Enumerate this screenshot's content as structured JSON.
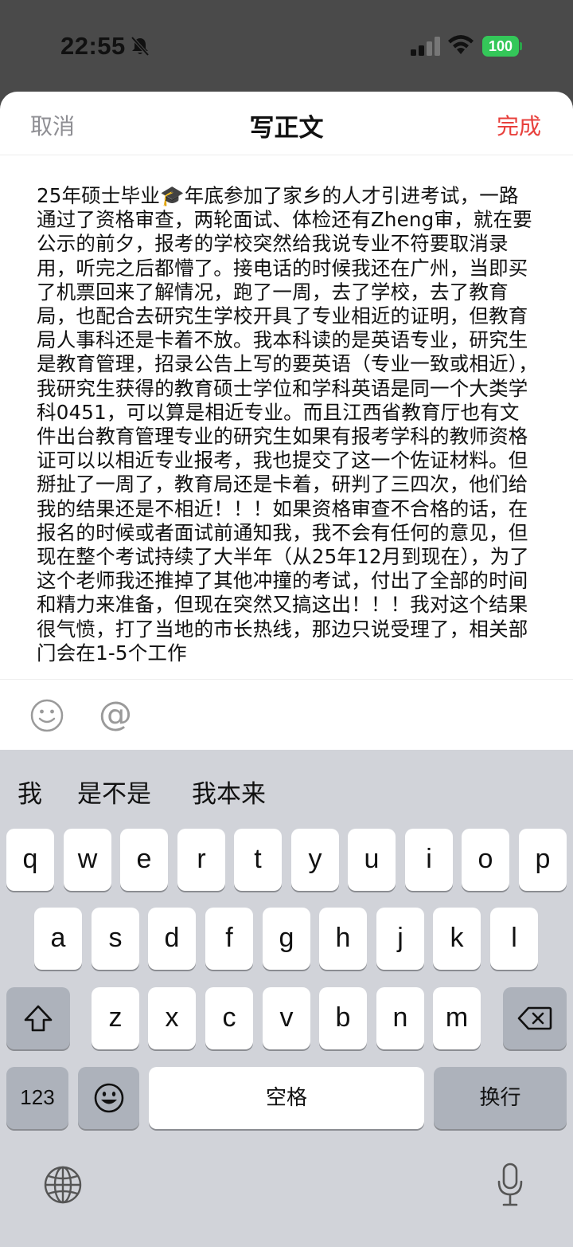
{
  "status": {
    "time": "22:55",
    "battery": "100",
    "icons": [
      "bell-slash-icon",
      "cellular-signal-icon",
      "wifi-icon",
      "battery-icon"
    ]
  },
  "nav": {
    "cancel": "取消",
    "title": "写正文",
    "done": "完成"
  },
  "editor": {
    "text": "25年硕士毕业🎓年底参加了家乡的人才引进考试，一路通过了资格审查，两轮面试、体检还有Zheng审，就在要公示的前夕，报考的学校突然给我说专业不符要取消录用，听完之后都懵了。接电话的时候我还在广州，当即买了机票回来了解情况，跑了一周，去了学校，去了教育局，也配合去研究生学校开具了专业相近的证明，但教育局人事科还是卡着不放。我本科读的是英语专业，研究生是教育管理，招录公告上写的要英语（专业一致或相近），我研究生获得的教育硕士学位和学科英语是同一个大类学科0451，可以算是相近专业。而且江西省教育厅也有文件出台教育管理专业的研究生如果有报考学科的教师资格证可以以相近专业报考，我也提交了这一个佐证材料。但掰扯了一周了，教育局还是卡着，研判了三四次，他们给我的结果还是不相近！！！如果资格审查不合格的话，在报名的时候或者面试前通知我，我不会有任何的意见，但现在整个考试持续了大半年（从25年12月到现在），为了这个老师我还推掉了其他冲撞的考试，付出了全部的时间和精力来准备，但现在突然又搞这出！！！我对这个结果很气愤，打了当地的市长热线，那边只说受理了，相关部门会在1-5个工作"
  },
  "toolbar": {
    "emoji_icon": "smiley-icon",
    "mention": "@"
  },
  "keyboard": {
    "suggestions": [
      "我",
      "是不是",
      "我本来"
    ],
    "row1": [
      "q",
      "w",
      "e",
      "r",
      "t",
      "y",
      "u",
      "i",
      "o",
      "p"
    ],
    "row2": [
      "a",
      "s",
      "d",
      "f",
      "g",
      "h",
      "j",
      "k",
      "l"
    ],
    "row3": [
      "z",
      "x",
      "c",
      "v",
      "b",
      "n",
      "m"
    ],
    "numbers": "123",
    "space": "空格",
    "return": "换行",
    "icons": [
      "shift-icon",
      "delete-icon",
      "emoji-icon",
      "globe-icon",
      "microphone-icon"
    ]
  }
}
